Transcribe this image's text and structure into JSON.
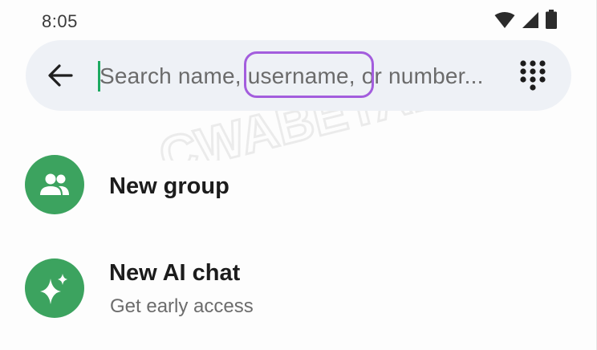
{
  "status_bar": {
    "time": "8:05",
    "icons": [
      "wifi-icon",
      "cell-signal-icon",
      "battery-icon"
    ]
  },
  "search": {
    "placeholder": "Search name, username, or number..."
  },
  "watermark_text": "CWABETAINFO",
  "highlight": {
    "target": "username,",
    "color": "#a35ddd"
  },
  "items": [
    {
      "title": "New group",
      "subtitle": "",
      "icon": "group-icon"
    },
    {
      "title": "New AI chat",
      "subtitle": "Get early access",
      "icon": "ai-sparkle-icon"
    }
  ],
  "colors": {
    "accent_green": "#3ca35f",
    "cursor_green": "#1daa61",
    "search_background": "#eef1f6"
  }
}
